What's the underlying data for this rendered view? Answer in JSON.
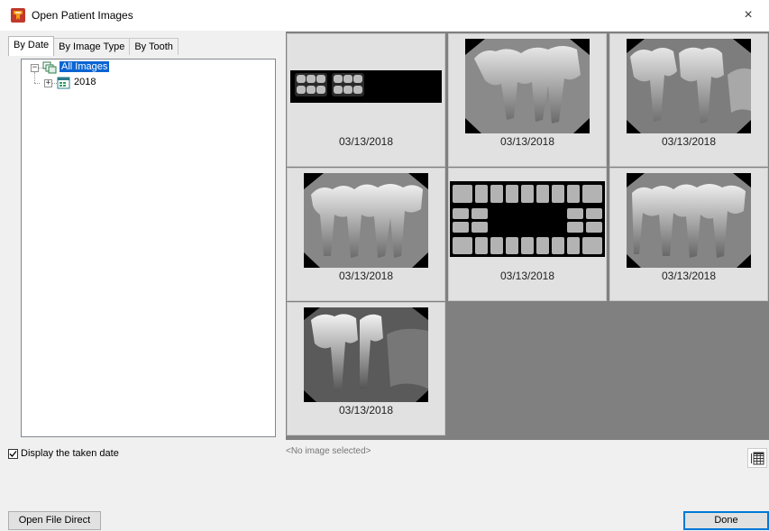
{
  "window": {
    "title": "Open Patient Images",
    "close_glyph": "×",
    "app_icon": "dental-app-icon"
  },
  "tabs": [
    {
      "label": "By Date",
      "active": true
    },
    {
      "label": "By Image Type",
      "active": false
    },
    {
      "label": "By Tooth",
      "active": false
    }
  ],
  "tree": {
    "root": {
      "label": "All Images",
      "expander": "⊟",
      "selected": true,
      "icon": "image-stack-icon"
    },
    "children": [
      {
        "label": "2018",
        "expander": "⊞",
        "icon": "calendar-images-icon"
      }
    ]
  },
  "thumbnails": [
    {
      "date": "03/13/2018",
      "kind": "bitewing-series"
    },
    {
      "date": "03/13/2018",
      "kind": "periapical"
    },
    {
      "date": "03/13/2018",
      "kind": "periapical"
    },
    {
      "date": "03/13/2018",
      "kind": "periapical"
    },
    {
      "date": "03/13/2018",
      "kind": "full-mouth-series"
    },
    {
      "date": "03/13/2018",
      "kind": "periapical"
    },
    {
      "date": "03/13/2018",
      "kind": "periapical"
    }
  ],
  "status_text": "<No image selected>",
  "display_date_checkbox": {
    "label": "Display the taken date",
    "checked": true
  },
  "buttons": {
    "open_file_direct": "Open File Direct",
    "done": "Done"
  },
  "colors": {
    "selection": "#0a64d2",
    "grid_background": "#808080",
    "cell_background": "#e1e1e1",
    "default_button_border": "#0078d7"
  }
}
